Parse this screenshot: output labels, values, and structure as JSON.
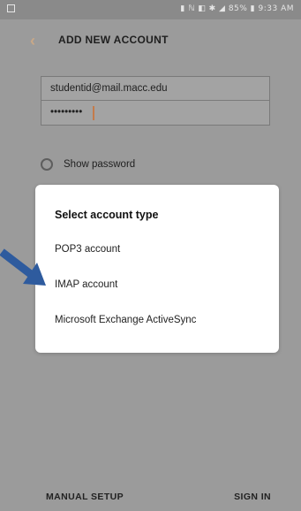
{
  "status_bar": {
    "text": "▮ ℕ ◧ ✱ ◢ 85% ▮ 9:33 AM"
  },
  "appbar": {
    "title": "ADD NEW ACCOUNT"
  },
  "form": {
    "email_value": "studentid@mail.macc.edu",
    "password_value": "•••••••••"
  },
  "show_password": {
    "label": "Show password"
  },
  "dialog": {
    "title": "Select account type",
    "options": [
      "POP3 account",
      "IMAP account",
      "Microsoft Exchange ActiveSync"
    ]
  },
  "bottom": {
    "manual_setup": "MANUAL SETUP",
    "sign_in": "SIGN IN"
  },
  "colors": {
    "overlay": "#9b9b9b",
    "accent": "#c9a887",
    "arrow": "#2e5b9e"
  }
}
